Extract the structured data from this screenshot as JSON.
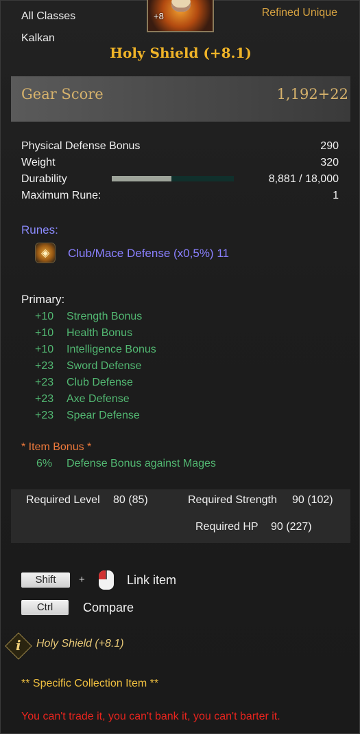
{
  "header": {
    "class_restriction": "All Classes",
    "item_type": "Kalkan",
    "grade": "Refined Unique",
    "icon_enhancement": "+8",
    "item_name": "Holy Shield (+8.1)"
  },
  "gear_score": {
    "label": "Gear Score",
    "value": "1,192+22"
  },
  "stats": [
    {
      "label": "Physical Defense Bonus",
      "value": "290"
    },
    {
      "label": "Weight",
      "value": "320"
    },
    {
      "label": "Durability",
      "value": "8,881 / 18,000"
    },
    {
      "label": "Maximum Rune:",
      "value": "1"
    }
  ],
  "durability_fraction": 0.49,
  "runes": {
    "label": "Runes:",
    "icon": "rune-flame-icon",
    "items": [
      {
        "text": "Club/Mace Defense (x0,5%) 11"
      }
    ]
  },
  "primary": {
    "label": "Primary:",
    "items": [
      {
        "value": "+10",
        "label": "Strength Bonus"
      },
      {
        "value": "+10",
        "label": "Health Bonus"
      },
      {
        "value": "+10",
        "label": "Intelligence Bonus"
      },
      {
        "value": "+23",
        "label": "Sword Defense"
      },
      {
        "value": "+23",
        "label": "Club Defense"
      },
      {
        "value": "+23",
        "label": "Axe Defense"
      },
      {
        "value": "+23",
        "label": "Spear Defense"
      }
    ]
  },
  "item_bonus": {
    "label": "*  Item Bonus *",
    "value": "6%",
    "text": "Defense Bonus against Mages"
  },
  "requirements": {
    "level_label": "Required Level",
    "level_value": "80 (85)",
    "strength_label": "Required Strength",
    "strength_value": "90 (102)",
    "hp_label": "Required HP",
    "hp_value": "90 (227)"
  },
  "hotkeys": {
    "shift_key": "Shift",
    "plus": "+",
    "link_label": "Link item",
    "ctrl_key": "Ctrl",
    "compare_label": "Compare"
  },
  "info": {
    "icon_letter": "i",
    "text": "Holy Shield (+8.1)"
  },
  "collection": "** Specific Collection Item **",
  "trade_warning": "You can't trade it, you can't bank it, you can't barter it.",
  "colors": {
    "grade": "#d9a441",
    "title": "#f0b428",
    "rune": "#8a80ff",
    "bonus_green": "#52b872",
    "bonus_header": "#ef7a3c",
    "warning": "#e8241e"
  }
}
